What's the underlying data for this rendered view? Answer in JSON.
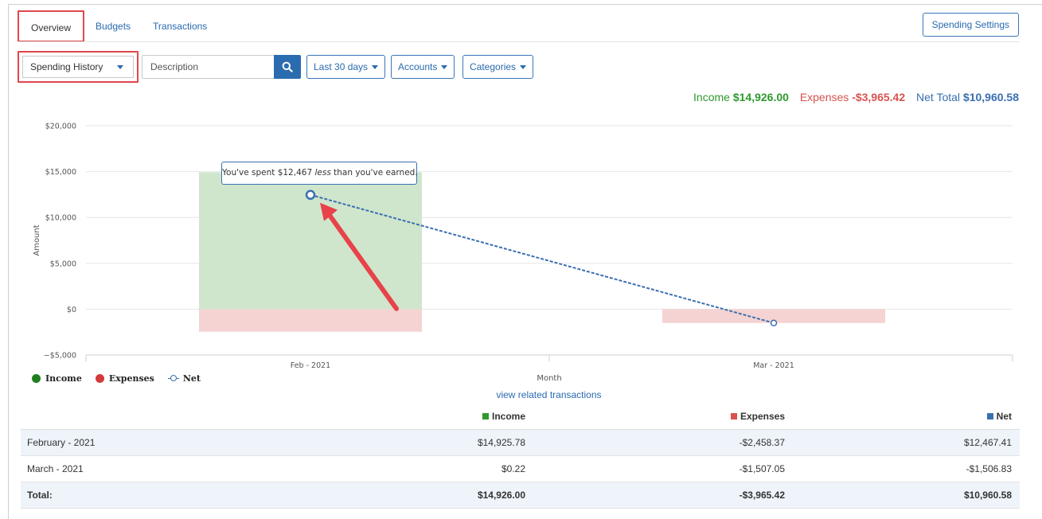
{
  "tabs": [
    {
      "label": "Overview",
      "active": true
    },
    {
      "label": "Budgets",
      "active": false
    },
    {
      "label": "Transactions",
      "active": false
    }
  ],
  "settings_button": "Spending Settings",
  "filters": {
    "view": "Spending History",
    "search_placeholder": "Description",
    "date_range": "Last 30 days",
    "accounts": "Accounts",
    "categories": "Categories"
  },
  "summary": {
    "income_label": "Income",
    "income_value": "$14,926.00",
    "expenses_label": "Expenses",
    "expenses_value": "-$3,965.42",
    "net_label": "Net Total",
    "net_value": "$10,960.58"
  },
  "tooltip": {
    "prefix": "You've spent $12,467",
    "emphasis": "less",
    "suffix": "than you've earned."
  },
  "legend": [
    "Income",
    "Expenses",
    "Net"
  ],
  "related_link": "view related transactions",
  "table": {
    "headers": [
      "",
      "Income",
      "Expenses",
      "Net"
    ],
    "rows": [
      {
        "label": "February - 2021",
        "income": "$14,925.78",
        "expenses": "-$2,458.37",
        "net": "$12,467.41"
      },
      {
        "label": "March - 2021",
        "income": "$0.22",
        "expenses": "-$1,507.05",
        "net": "-$1,506.83"
      }
    ],
    "total": {
      "label": "Total:",
      "income": "$14,926.00",
      "expenses": "-$3,965.42",
      "net": "$10,960.58"
    }
  },
  "colors": {
    "income": "#2e9a2e",
    "expenses": "#d9534f",
    "net": "#3a6fb0",
    "link": "#2a6ab0",
    "highlight_box": "#e0474c",
    "income_bar": "#cfe6cc",
    "expenses_bar": "#f5d3d3"
  },
  "chart_data": {
    "type": "bar",
    "categories": [
      "Feb - 2021",
      "Mar - 2021"
    ],
    "series": [
      {
        "name": "Income",
        "values": [
          14925.78,
          0.22
        ]
      },
      {
        "name": "Expenses",
        "values": [
          -2458.37,
          -1507.05
        ]
      },
      {
        "name": "Net",
        "values": [
          12467.41,
          -1506.83
        ]
      }
    ],
    "xlabel": "Month",
    "ylabel": "Amount",
    "yticks": [
      "$20,000",
      "$15,000",
      "$10,000",
      "$5,000",
      "$0",
      "−$5,000"
    ],
    "ylim": [
      -5000,
      20000
    ],
    "grid": true,
    "legend": "bottom-left"
  }
}
